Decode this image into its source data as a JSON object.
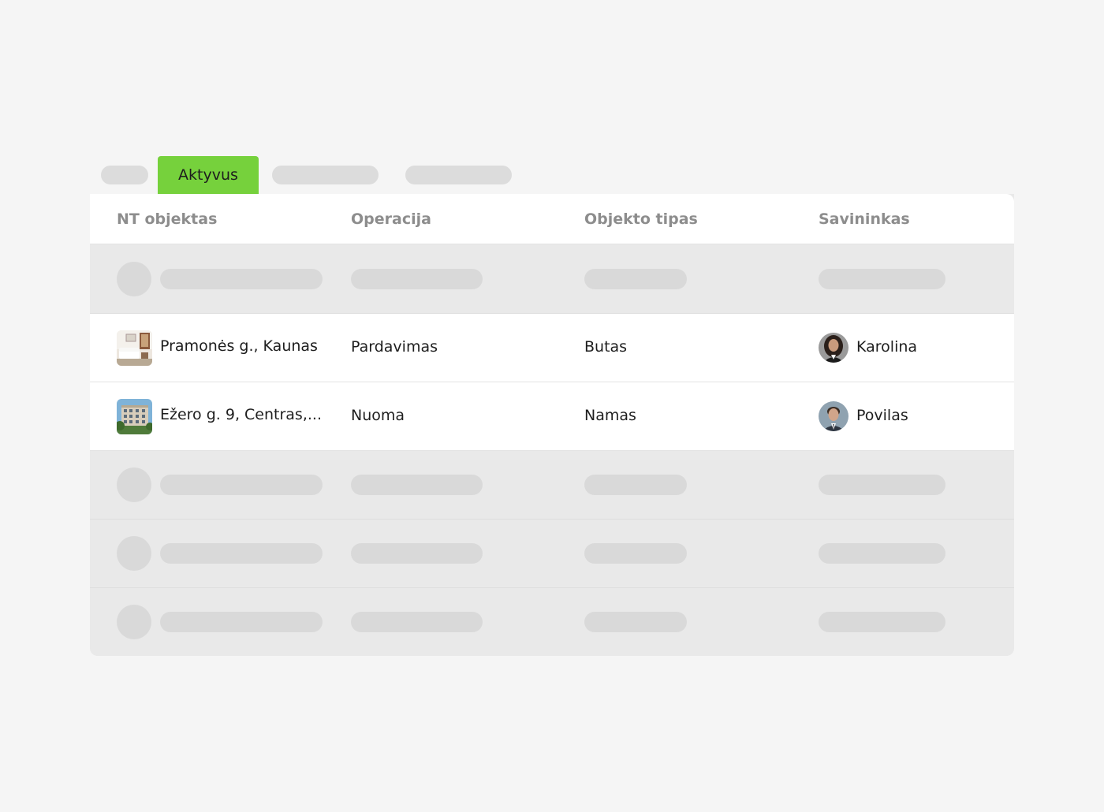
{
  "tabs": {
    "active_label": "Aktyvus"
  },
  "table": {
    "headers": [
      "NT objektas",
      "Operacija",
      "Objekto tipas",
      "Savininkas"
    ],
    "rows": [
      {
        "property": "Pramonės g., Kaunas",
        "operation": "Pardavimas",
        "type": "Butas",
        "owner": "Karolina"
      },
      {
        "property": "Ežero g. 9, Centras,...",
        "operation": "Nuoma",
        "type": "Namas",
        "owner": "Povilas"
      }
    ]
  },
  "colors": {
    "accent": "#76d13c",
    "background": "#f5f5f5",
    "skeleton": "#d9d9d9"
  }
}
